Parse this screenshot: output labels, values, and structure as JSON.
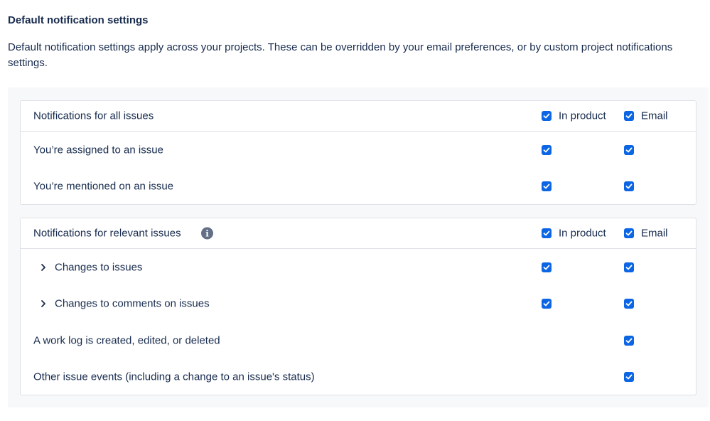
{
  "heading": "Default notification settings",
  "description": "Default notification settings apply across your projects. These can be overridden by your email preferences, or by custom project notifications settings.",
  "colors": {
    "checkbox": "#0c66e4",
    "text": "#172b4d",
    "panel": "#f7f8f9",
    "border": "#dfe1e6"
  },
  "all_issues": {
    "title": "Notifications for all issues",
    "in_product_label": "In product",
    "email_label": "Email",
    "in_product_checked": true,
    "email_checked": true,
    "rows": [
      {
        "label": "You’re assigned to an issue",
        "in_product": true,
        "email": true
      },
      {
        "label": "You’re mentioned on an issue",
        "in_product": true,
        "email": true
      }
    ]
  },
  "relevant_issues": {
    "title": "Notifications for relevant issues",
    "info_icon": "info-icon",
    "in_product_label": "In product",
    "email_label": "Email",
    "in_product_checked": true,
    "email_checked": true,
    "rows": [
      {
        "label": "Changes to issues",
        "expandable": true,
        "in_product": true,
        "email": true
      },
      {
        "label": "Changes to comments on issues",
        "expandable": true,
        "in_product": true,
        "email": true
      },
      {
        "label": "A work log is created, edited, or deleted",
        "expandable": false,
        "in_product": null,
        "email": true
      },
      {
        "label": "Other issue events (including a change to an issue's status)",
        "expandable": false,
        "in_product": null,
        "email": true
      }
    ]
  }
}
